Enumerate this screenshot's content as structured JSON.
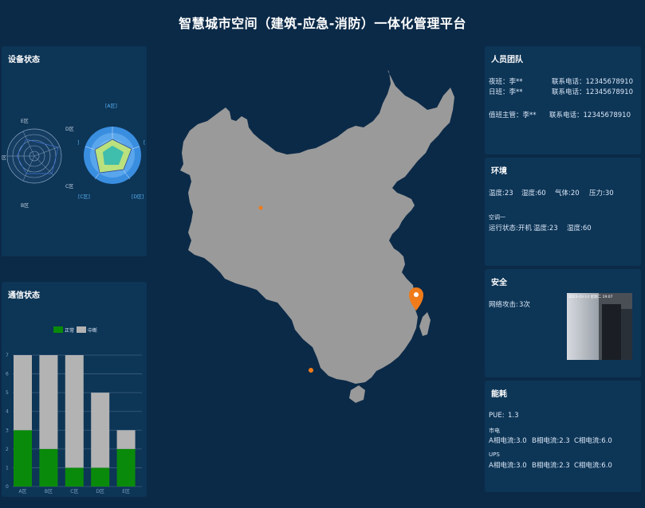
{
  "title": "智慧城市空间（建筑-应急-消防）一体化管理平台",
  "device_status": {
    "title": "设备状态",
    "radar1_labels": [
      "E区",
      "D区",
      "C区",
      "B区",
      "区"
    ],
    "radar2_labels": [
      "[A区]",
      "[D区]",
      "[C区]",
      "[",
      "]"
    ]
  },
  "comm_status": {
    "title": "通信状态",
    "legend": [
      "正常",
      "中断"
    ],
    "colors": {
      "normal": "#0a8a0a",
      "interrupt": "#b3b3b3"
    }
  },
  "chart_data": {
    "type": "bar",
    "stacked": true,
    "categories": [
      "A区",
      "B区",
      "C区",
      "D区",
      "E区"
    ],
    "series": [
      {
        "name": "正常",
        "values": [
          3,
          2,
          1,
          1,
          2
        ]
      },
      {
        "name": "中断",
        "values": [
          4,
          5,
          6,
          4,
          1
        ]
      }
    ],
    "ylim": [
      0,
      7
    ],
    "yticks": [
      "0",
      "1",
      "2",
      "3",
      "4",
      "5",
      "6",
      "7"
    ],
    "legend_position": "top",
    "grid": true
  },
  "personnel": {
    "title": "人员团队",
    "rows": [
      {
        "role": "夜班：李**",
        "phone": "联系电话：12345678910"
      },
      {
        "role": "日班：李**",
        "phone": "联系电话：12345678910"
      },
      {
        "role": "值班主管：李**",
        "phone": "联系电话：12345678910"
      }
    ]
  },
  "environment": {
    "title": "环境",
    "temp": "温度:23",
    "humidity": "湿度:60",
    "gas": "气体:20",
    "pressure": "压力:30",
    "ac_label": "空调一",
    "ac_status": "运行状态:开机",
    "ac_temp": "温度:23",
    "ac_humidity": "湿度:60"
  },
  "security": {
    "title": "安全",
    "attack_label": "网络攻击:",
    "attack_count": "3次",
    "camera_timestamp": "2023-03-14 星期二 19:07"
  },
  "energy": {
    "title": "能耗",
    "pue_label": "PUE:",
    "pue_value": "1.3",
    "mains_label": "市电",
    "mains_a": "A相电流:3.0",
    "mains_b": "B相电流:2.3",
    "mains_c": "C相电流:6.0",
    "ups_label": "UPS",
    "ups_a": "A相电流:3.0",
    "ups_b": "B相电流:2.3",
    "ups_c": "C相电流:6.0"
  },
  "map": {
    "land_color": "#9a9a9a",
    "marker_color": "#f07b1a"
  }
}
